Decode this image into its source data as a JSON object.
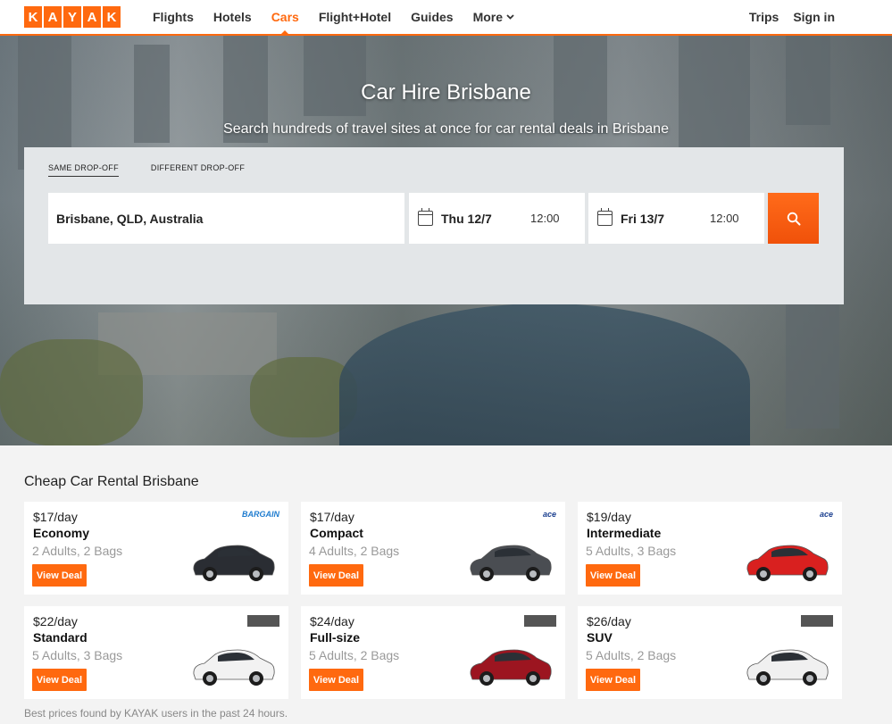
{
  "header": {
    "logo_letters": [
      "K",
      "A",
      "Y",
      "A",
      "K"
    ],
    "nav": [
      {
        "label": "Flights"
      },
      {
        "label": "Hotels"
      },
      {
        "label": "Cars"
      },
      {
        "label": "Flight+Hotel"
      },
      {
        "label": "Guides"
      },
      {
        "label": "More"
      }
    ],
    "active_nav": "Cars",
    "right_nav": [
      {
        "label": "Trips"
      },
      {
        "label": "Sign in"
      }
    ]
  },
  "hero": {
    "title": "Car Hire Brisbane",
    "subtitle": "Search hundreds of travel sites at once for car rental deals in Brisbane"
  },
  "search": {
    "tabs": [
      {
        "label": "SAME DROP-OFF",
        "active": true
      },
      {
        "label": "DIFFERENT DROP-OFF",
        "active": false
      }
    ],
    "location": "Brisbane, QLD, Australia",
    "pickup": {
      "date": "Thu 12/7",
      "time": "12:00"
    },
    "dropoff": {
      "date": "Fri 13/7",
      "time": "12:00"
    },
    "button_icon": "search-icon"
  },
  "deals": {
    "title": "Cheap Car Rental Brisbane",
    "button_label": "View Deal",
    "cards": [
      {
        "price": "$17/day",
        "class": "Economy",
        "capacity": "2 Adults, 2 Bags",
        "brand": "BARGAIN",
        "car_color": "#2a2d33"
      },
      {
        "price": "$17/day",
        "class": "Compact",
        "capacity": "4 Adults, 2 Bags",
        "brand": "ace",
        "car_color": "#4a4d52"
      },
      {
        "price": "$19/day",
        "class": "Intermediate",
        "capacity": "5 Adults, 3 Bags",
        "brand": "ace",
        "car_color": "#d9201f"
      },
      {
        "price": "$22/day",
        "class": "Standard",
        "capacity": "5 Adults, 3 Bags",
        "brand": "",
        "car_color": "#f2f2f2"
      },
      {
        "price": "$24/day",
        "class": "Full-size",
        "capacity": "5 Adults, 2 Bags",
        "brand": "",
        "car_color": "#9c1520"
      },
      {
        "price": "$26/day",
        "class": "SUV",
        "capacity": "5 Adults, 2 Bags",
        "brand": "",
        "car_color": "#f0f0f0"
      }
    ],
    "footnote": "Best prices found by KAYAK users in the past 24 hours."
  },
  "colors": {
    "accent": "#ff690f"
  }
}
